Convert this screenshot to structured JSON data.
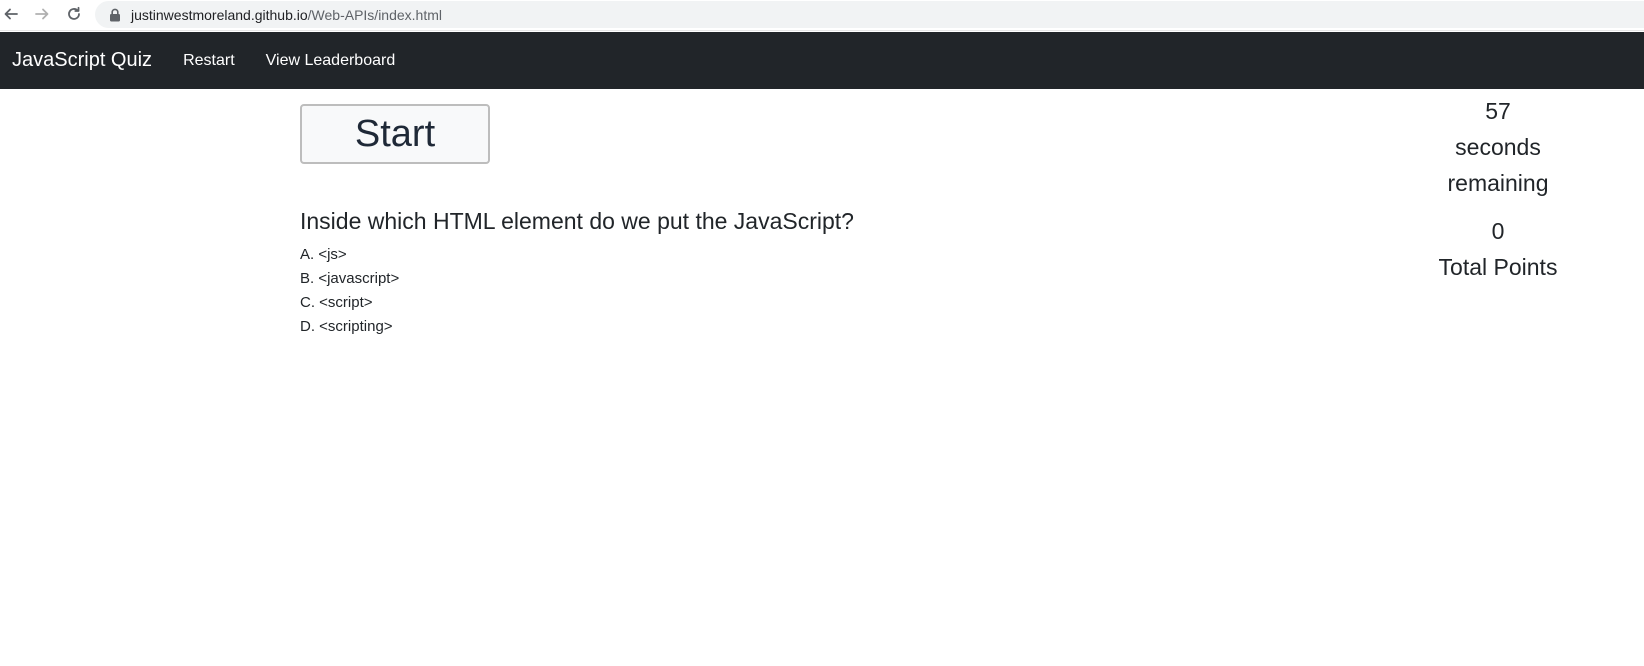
{
  "browser": {
    "url_host": "justinwestmoreland.github.io",
    "url_path": "/Web-APIs/index.html",
    "back_icon": "arrow-left-icon",
    "forward_icon": "arrow-right-icon",
    "reload_icon": "reload-icon",
    "lock_icon": "lock-icon"
  },
  "navbar": {
    "brand": "JavaScript Quiz",
    "links": [
      "Restart",
      "View Leaderboard"
    ],
    "background": "#212529"
  },
  "main": {
    "start_label": "Start",
    "question": "Inside which HTML element do we put the JavaScript?",
    "answers": [
      "A. <js>",
      "B. <javascript>",
      "C. <script>",
      "D. <scripting>"
    ]
  },
  "sidebar": {
    "timer_value": "57",
    "timer_label_1": "seconds",
    "timer_label_2": "remaining",
    "score_value": "0",
    "score_label": "Total Points"
  }
}
